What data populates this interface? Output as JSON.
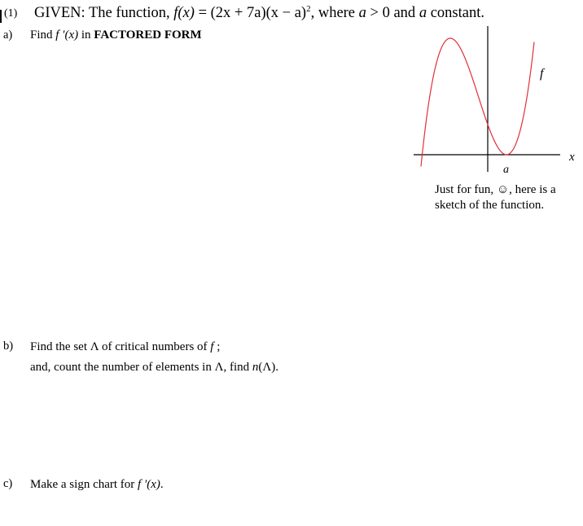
{
  "problem": {
    "number": "(1)",
    "given_prefix": "GIVEN:   The function, ",
    "function_name": "f(x)",
    "equals": " = ",
    "expression_part1": "(2x + 7a)(x − a)",
    "exponent": "2",
    "given_suffix_1": ", where ",
    "var_a": "a",
    "given_suffix_2": " > 0 and ",
    "var_a2": "a",
    "given_suffix_3": " constant."
  },
  "parts": {
    "a": {
      "label": "a)",
      "text_prefix": "Find ",
      "math": "f ′(x)",
      "text_middle": " in ",
      "text_bold": "FACTORED FORM"
    },
    "b": {
      "label": "b)",
      "line1_prefix": "Find the set Λ of critical numbers of ",
      "line1_math": "f",
      "line1_suffix": " ;",
      "line2_prefix": "and,  count the number of elements in Λ, find ",
      "line2_math": "n",
      "line2_suffix": "(Λ)."
    },
    "c": {
      "label": "c)",
      "text_prefix": "Make a sign chart for ",
      "math": "f ′(x)",
      "text_suffix": "."
    }
  },
  "sketch": {
    "curve_label": "f",
    "x_axis_label": "x",
    "root_label": "a",
    "curve_color": "#e0303a",
    "axis_color": "#000000",
    "caption_line1": "Just for fun, ☺, here is a",
    "caption_line2": "sketch of the function."
  }
}
